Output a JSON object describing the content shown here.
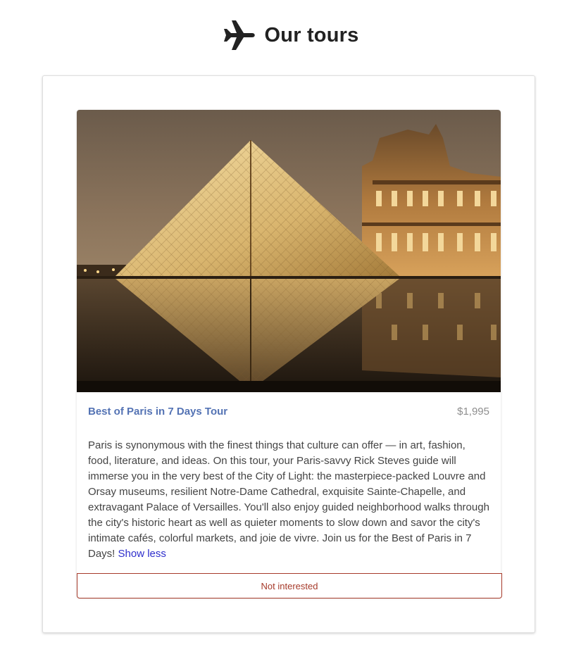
{
  "header": {
    "icon": "airplane-icon",
    "title": "Our tours"
  },
  "tour": {
    "image_subject": "louvre-pyramid-photo",
    "name": "Best of Paris in 7 Days Tour",
    "price": "$1,995",
    "description": "Paris is synonymous with the finest things that culture can offer — in art, fashion, food, literature, and ideas. On this tour, your Paris-savvy Rick Steves guide will immerse you in the very best of the City of Light: the masterpiece-packed Louvre and Orsay museums, resilient Notre-Dame Cathedral, exquisite Sainte-Chapelle, and extravagant Palace of Versailles. You'll also enjoy guided neighborhood walks through the city's historic heart as well as quieter moments to slow down and savor the city's intimate cafés, colorful markets, and joie de vivre. Join us for the Best of Paris in 7 Days!",
    "toggle_label": "Show less",
    "dismiss_label": "Not interested"
  },
  "colors": {
    "title_link": "#5473b4",
    "price": "#8e8e8e",
    "toggle_link": "#2e2ecc",
    "dismiss": "#a63a2a"
  }
}
